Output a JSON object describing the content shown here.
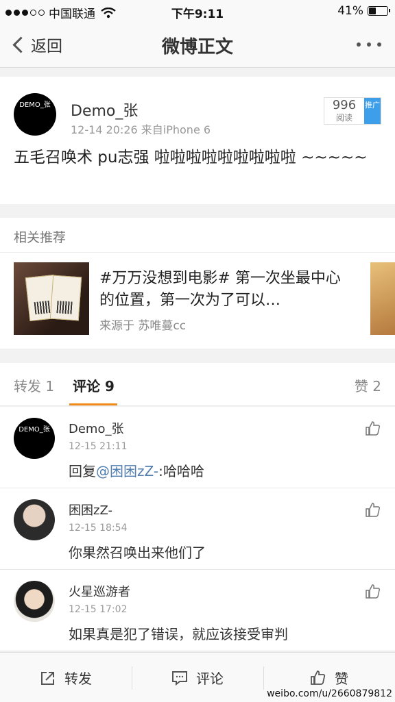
{
  "status_bar": {
    "carrier": "中国联通",
    "time": "下午9:11",
    "battery_text": "41%",
    "battery_level": 0.41
  },
  "nav": {
    "back_label": "返回",
    "title": "微博正文"
  },
  "post": {
    "avatar_text": "DEMO_张",
    "author": "Demo_张",
    "meta": "12-14 20:26  来自iPhone 6",
    "read_count": "996",
    "read_label": "阅读",
    "promo_label": "推广",
    "text": "五毛召唤术 pu志强 啦啦啦啦啦啦啦啦啦 ~~~~~"
  },
  "related": {
    "header": "相关推荐",
    "title": "#万万没想到电影# 第一次坐最中心的位置，第一次为了可以…",
    "source": "来源于 苏唯蔓cc"
  },
  "tabs": {
    "repost": "转发 1",
    "comments": "评论 9",
    "likes": "赞 2"
  },
  "comments": [
    {
      "name": "Demo_张",
      "time": "12-15 21:11",
      "text_prefix": "回复",
      "mention": "@困困zZ-",
      "text_suffix": ":哈哈哈",
      "avatar_text": "DEMO_张"
    },
    {
      "name": "困困zZ-",
      "time": "12-15 18:54",
      "text": "你果然召唤出来他们了"
    },
    {
      "name": "火星巡游者",
      "time": "12-15 17:02",
      "text": "如果真是犯了错误，就应该接受审判"
    }
  ],
  "bottom_bar": {
    "repost": "转发",
    "comment": "评论",
    "like": "赞"
  },
  "watermark": "weibo.com/u/2660879812",
  "colors": {
    "accent": "#f28a1b",
    "link": "#507daf",
    "promo": "#3d9ee9"
  }
}
